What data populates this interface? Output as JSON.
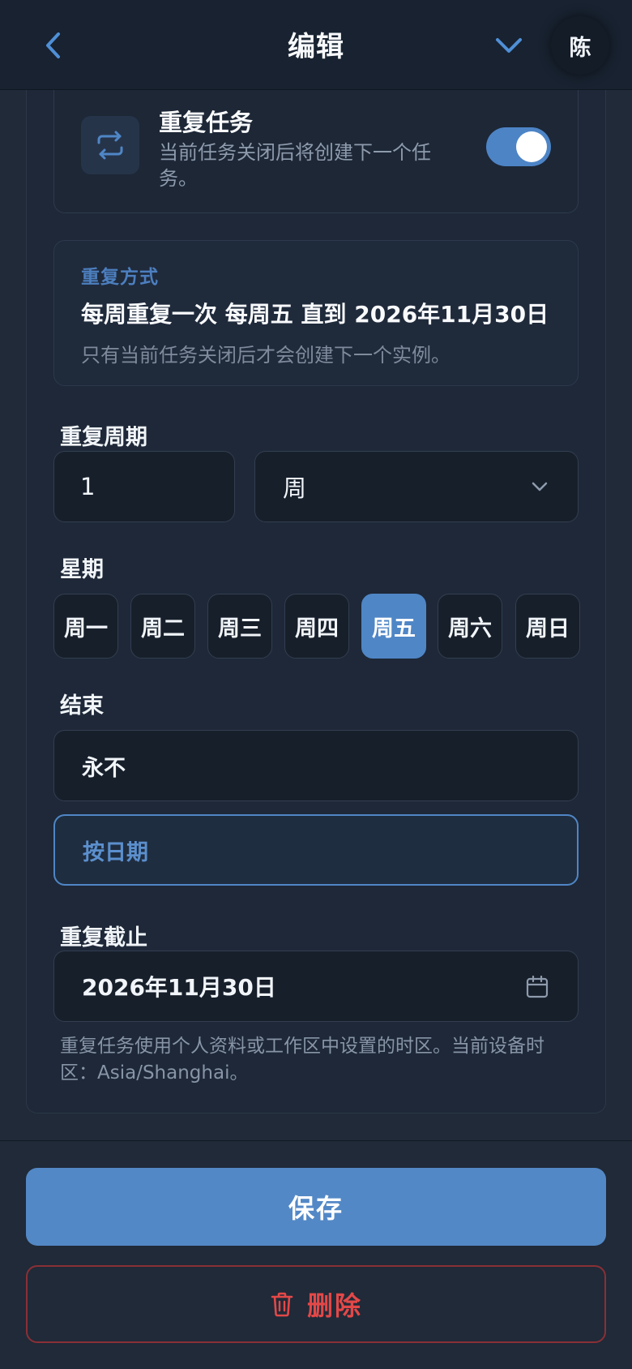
{
  "header": {
    "title": "编辑",
    "avatar_initial": "陈",
    "back_icon": "chevron-left-icon",
    "collapse_icon": "chevron-down-icon"
  },
  "repeat_task": {
    "title": "重复任务",
    "description": "当前任务关闭后将创建下一个任务。",
    "enabled": true,
    "icon": "repeat-icon"
  },
  "repeat_mode": {
    "label": "重复方式",
    "summary": "每周重复一次 每周五 直到 2026年11月30日",
    "note": "只有当前任务关闭后才会创建下一个实例。"
  },
  "interval": {
    "label": "重复周期",
    "value": "1",
    "unit": "周"
  },
  "weekdays": {
    "label": "星期",
    "days": [
      "周一",
      "周二",
      "周三",
      "周四",
      "周五",
      "周六",
      "周日"
    ],
    "selected": "周五"
  },
  "end": {
    "label": "结束",
    "option_never": "永不",
    "option_by_date": "按日期",
    "selected": "按日期"
  },
  "until": {
    "label": "重复截止",
    "date": "2026年11月30日",
    "icon": "calendar-icon"
  },
  "timezone_note": "重复任务使用个人资料或工作区中设置的时区。当前设备时区：Asia/Shanghai。",
  "actions": {
    "save": "保存",
    "delete": "删除",
    "delete_icon": "trash-icon"
  },
  "colors": {
    "accent": "#4f86c6",
    "danger": "#e34848",
    "background": "#202a38"
  }
}
